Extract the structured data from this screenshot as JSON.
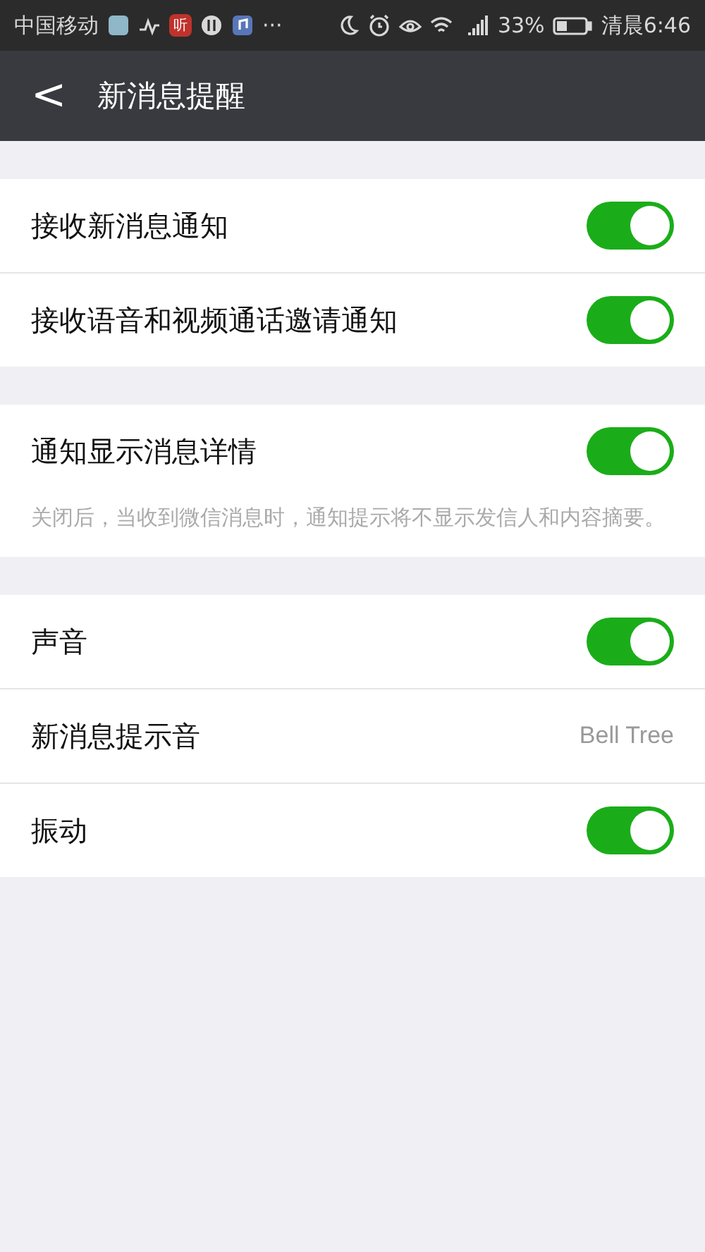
{
  "status_bar": {
    "carrier": "中国移动",
    "app_icon_text": "听",
    "more": "···",
    "battery_percent": "33%",
    "time": "清晨6:46"
  },
  "header": {
    "back": "<",
    "title": "新消息提醒"
  },
  "groups": [
    {
      "items": [
        {
          "kind": "toggle",
          "label": "接收新消息通知",
          "on": true
        },
        {
          "kind": "toggle",
          "label": "接收语音和视频通话邀请通知",
          "on": true
        }
      ]
    },
    {
      "items": [
        {
          "kind": "toggle",
          "label": "通知显示消息详情",
          "on": true
        }
      ],
      "note": "关闭后，当收到微信消息时，通知提示将不显示发信人和内容摘要。"
    },
    {
      "items": [
        {
          "kind": "toggle",
          "label": "声音",
          "on": true
        },
        {
          "kind": "value",
          "label": "新消息提示音",
          "value": "Bell Tree"
        },
        {
          "kind": "toggle",
          "label": "振动",
          "on": true
        }
      ]
    }
  ]
}
